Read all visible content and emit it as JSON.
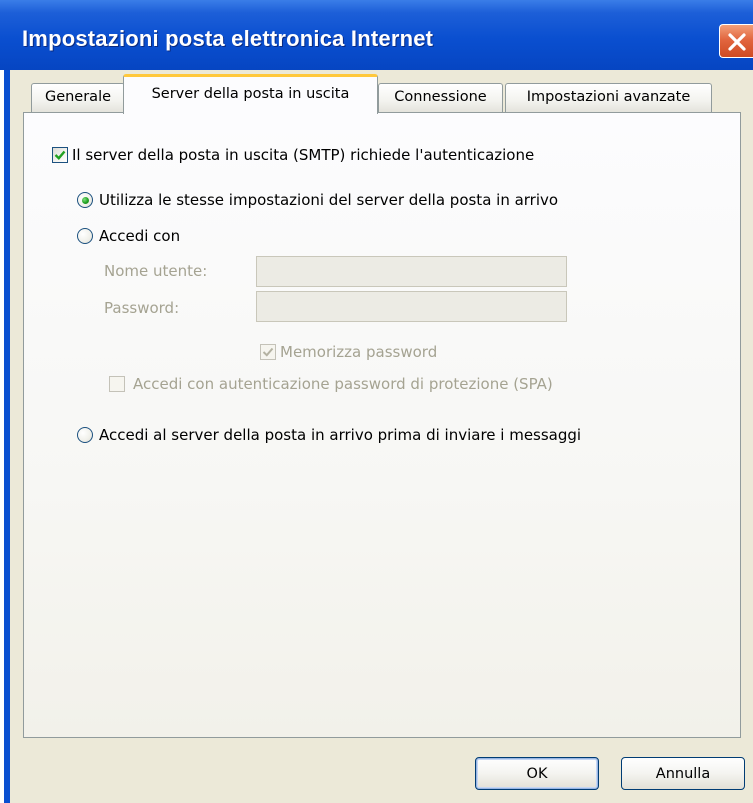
{
  "window": {
    "title": "Impostazioni posta elettronica Internet",
    "close_icon": "close-icon"
  },
  "tabs": [
    {
      "label": "Generale",
      "selected": false
    },
    {
      "label": "Server della posta in uscita",
      "selected": true
    },
    {
      "label": "Connessione",
      "selected": false
    },
    {
      "label": "Impostazioni avanzate",
      "selected": false
    }
  ],
  "auth": {
    "smtp_requires_auth_label": "Il server della posta in uscita (SMTP) richiede l'autenticazione",
    "smtp_requires_auth_checked": true,
    "options": [
      {
        "label": "Utilizza le stesse impostazioni del server della posta in arrivo",
        "selected": true
      },
      {
        "label": "Accedi con",
        "selected": false
      },
      {
        "label": "Accedi al server della posta in arrivo prima di inviare i messaggi",
        "selected": false
      }
    ],
    "login": {
      "username_label": "Nome utente:",
      "username_value": "",
      "password_label": "Password:",
      "password_value": "",
      "remember_password_label": "Memorizza password",
      "remember_password_checked": true,
      "spa_label": "Accedi con autenticazione password di protezione (SPA)",
      "spa_checked": false
    }
  },
  "buttons": {
    "ok_label": "OK",
    "cancel_label": "Annulla"
  },
  "colors": {
    "titlebar": "#0a4fd0",
    "dialog_bg": "#ece9d8",
    "selected_tab_accent": "#ffc83c",
    "check_mark": "#21a121",
    "disabled_text": "#a5a392"
  }
}
